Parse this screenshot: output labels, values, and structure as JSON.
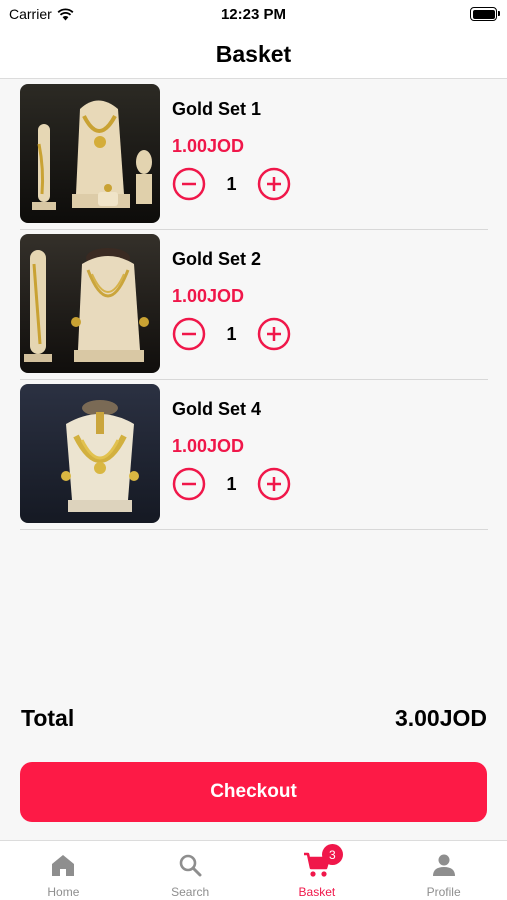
{
  "status_bar": {
    "carrier": "Carrier",
    "time": "12:23 PM"
  },
  "header": {
    "title": "Basket"
  },
  "cart": {
    "items": [
      {
        "name": "Gold Set 1",
        "price": "1.00JOD",
        "quantity": "1"
      },
      {
        "name": "Gold Set 2",
        "price": "1.00JOD",
        "quantity": "1"
      },
      {
        "name": "Gold Set 4",
        "price": "1.00JOD",
        "quantity": "1"
      }
    ]
  },
  "summary": {
    "total_label": "Total",
    "total_value": "3.00JOD"
  },
  "checkout": {
    "label": "Checkout"
  },
  "tab_bar": {
    "tabs": [
      {
        "label": "Home",
        "icon": "home-icon"
      },
      {
        "label": "Search",
        "icon": "search-icon"
      },
      {
        "label": "Basket",
        "icon": "cart-icon",
        "badge": "3"
      },
      {
        "label": "Profile",
        "icon": "person-icon"
      }
    ],
    "active": "Basket"
  },
  "colors": {
    "accent": "#f0174a",
    "checkout_bg": "#fd1a46",
    "inactive": "#8e8e8e"
  }
}
